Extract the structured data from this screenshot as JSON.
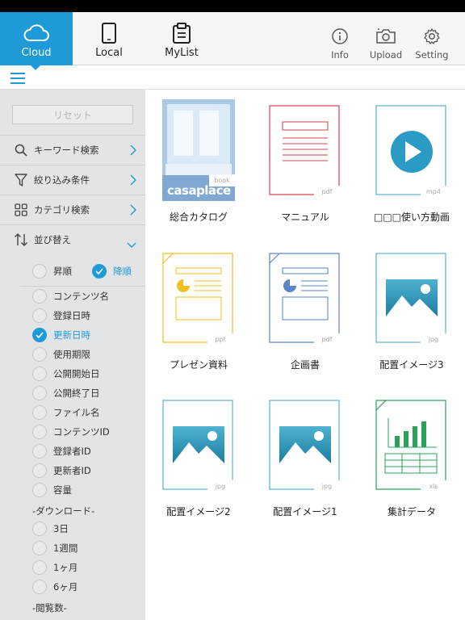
{
  "nav": {
    "tabs": [
      {
        "label": "Cloud",
        "icon": "cloud-icon",
        "active": true
      },
      {
        "label": "Local",
        "icon": "tablet-icon",
        "active": false
      },
      {
        "label": "MyList",
        "icon": "clipboard-icon",
        "active": false
      }
    ],
    "tools": [
      {
        "label": "Info",
        "icon": "info-icon"
      },
      {
        "label": "Upload",
        "icon": "camera-icon"
      },
      {
        "label": "Setting",
        "icon": "gear-icon"
      }
    ]
  },
  "sidebar": {
    "reset_label": "リセット",
    "menu": [
      {
        "label": "キーワード検索",
        "icon": "search-icon"
      },
      {
        "label": "絞り込み条件",
        "icon": "filter-icon"
      },
      {
        "label": "カテゴリ検索",
        "icon": "category-icon"
      },
      {
        "label": "並び替え",
        "icon": "sort-icon"
      }
    ],
    "order": [
      {
        "label": "昇順",
        "selected": false
      },
      {
        "label": "降順",
        "selected": true
      }
    ],
    "sort_fields": [
      {
        "label": "コンテンツ名",
        "selected": false
      },
      {
        "label": "登録日時",
        "selected": false
      },
      {
        "label": "更新日時",
        "selected": true
      },
      {
        "label": "使用期限",
        "selected": false
      },
      {
        "label": "公開開始日",
        "selected": false
      },
      {
        "label": "公開終了日",
        "selected": false
      },
      {
        "label": "ファイル名",
        "selected": false
      },
      {
        "label": "コンテンツID",
        "selected": false
      },
      {
        "label": "登録者ID",
        "selected": false
      },
      {
        "label": "更新者ID",
        "selected": false
      },
      {
        "label": "容量",
        "selected": false
      }
    ],
    "download_header": "-ダウンロード-",
    "download_options": [
      {
        "label": "3日",
        "selected": false
      },
      {
        "label": "1週間",
        "selected": false
      },
      {
        "label": "1ヶ月",
        "selected": false
      },
      {
        "label": "6ヶ月",
        "selected": false
      }
    ],
    "views_header": "-閲覧数-"
  },
  "colors": {
    "accent": "#1e9bd7",
    "pdf": "#d9444a",
    "ppt": "#f0c020",
    "doc": "#5a86c8",
    "xls": "#2aa05a",
    "video": "#5bb0d0"
  },
  "items": [
    {
      "name": "総合カタログ",
      "type": "book",
      "ext": "book",
      "cover_text": "casaplace"
    },
    {
      "name": "マニュアル",
      "type": "pdf-text",
      "ext": "pdf"
    },
    {
      "name": "□□□使い方動画",
      "type": "video",
      "ext": "mp4"
    },
    {
      "name": "プレゼン資料",
      "type": "ppt",
      "ext": "ppt"
    },
    {
      "name": "企画書",
      "type": "pdf-chart",
      "ext": "pdf"
    },
    {
      "name": "配置イメージ3",
      "type": "image",
      "ext": "jpg"
    },
    {
      "name": "配置イメージ2",
      "type": "image",
      "ext": "jpg"
    },
    {
      "name": "配置イメージ1",
      "type": "image",
      "ext": "jpg"
    },
    {
      "name": "集計データ",
      "type": "xls",
      "ext": "xls"
    }
  ]
}
